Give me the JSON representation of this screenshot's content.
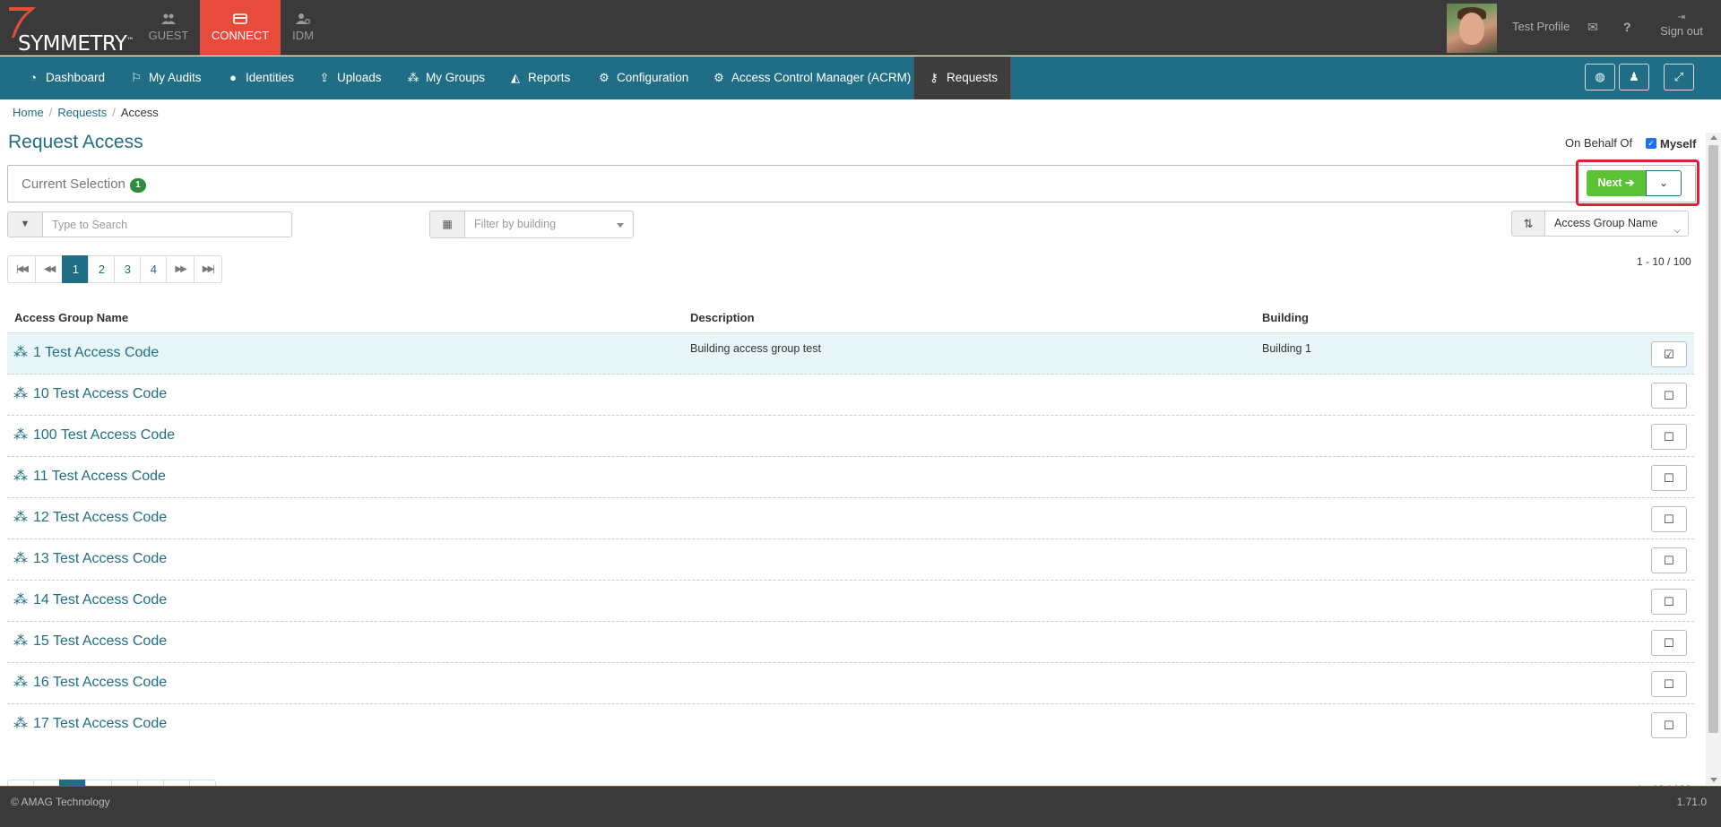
{
  "brand": {
    "name": "SYMMETRY",
    "tm": "™"
  },
  "apps": [
    {
      "label": "GUEST",
      "icon": "users-icon"
    },
    {
      "label": "CONNECT",
      "icon": "card-icon",
      "active": true
    },
    {
      "label": "IDM",
      "icon": "user-settings-icon"
    }
  ],
  "header": {
    "profile_name": "Test Profile",
    "signout": "Sign out"
  },
  "nav": {
    "items": [
      {
        "label": "Dashboard",
        "icon": "dashboard-icon"
      },
      {
        "label": "My Audits",
        "icon": "flag-icon"
      },
      {
        "label": "Identities",
        "icon": "user-icon"
      },
      {
        "label": "Uploads",
        "icon": "upload-icon"
      },
      {
        "label": "My Groups",
        "icon": "group-icon"
      },
      {
        "label": "Reports",
        "icon": "area-chart-icon"
      },
      {
        "label": "Configuration",
        "icon": "gear-icon"
      },
      {
        "label": "Access Control Manager (ACRM)",
        "icon": "gear-icon"
      },
      {
        "label": "Requests",
        "icon": "key-icon",
        "active": true
      }
    ]
  },
  "breadcrumb": [
    "Home",
    "Requests",
    "Access"
  ],
  "page": {
    "title": "Request Access",
    "on_behalf_of": "On Behalf Of",
    "myself": "Myself",
    "current_selection": "Current Selection",
    "selection_count": "1",
    "next_label": "Next"
  },
  "filters": {
    "search_placeholder": "Type to Search",
    "building_placeholder": "Filter by building",
    "sort_value": "Access Group Name"
  },
  "pagination": {
    "pages": [
      "1",
      "2",
      "3",
      "4"
    ],
    "active": "1",
    "range": "1 - 10 / 100"
  },
  "table": {
    "headers": [
      "Access Group Name",
      "Description",
      "Building"
    ],
    "rows": [
      {
        "name": "1 Test Access Code",
        "description": "Building access group test",
        "building": "Building 1",
        "checked": true
      },
      {
        "name": "10 Test Access Code",
        "description": "",
        "building": "",
        "checked": false
      },
      {
        "name": "100 Test Access Code",
        "description": "",
        "building": "",
        "checked": false
      },
      {
        "name": "11 Test Access Code",
        "description": "",
        "building": "",
        "checked": false
      },
      {
        "name": "12 Test Access Code",
        "description": "",
        "building": "",
        "checked": false
      },
      {
        "name": "13 Test Access Code",
        "description": "",
        "building": "",
        "checked": false
      },
      {
        "name": "14 Test Access Code",
        "description": "",
        "building": "",
        "checked": false
      },
      {
        "name": "15 Test Access Code",
        "description": "",
        "building": "",
        "checked": false
      },
      {
        "name": "16 Test Access Code",
        "description": "",
        "building": "",
        "checked": false
      },
      {
        "name": "17 Test Access Code",
        "description": "",
        "building": "",
        "checked": false
      }
    ]
  },
  "footer": {
    "copyright": "© AMAG Technology",
    "version": "1.71.0"
  },
  "colors": {
    "nav": "#1f6e86",
    "header": "#3a3a3a",
    "accent_red": "#e64b3c",
    "next_green": "#5bc236"
  }
}
